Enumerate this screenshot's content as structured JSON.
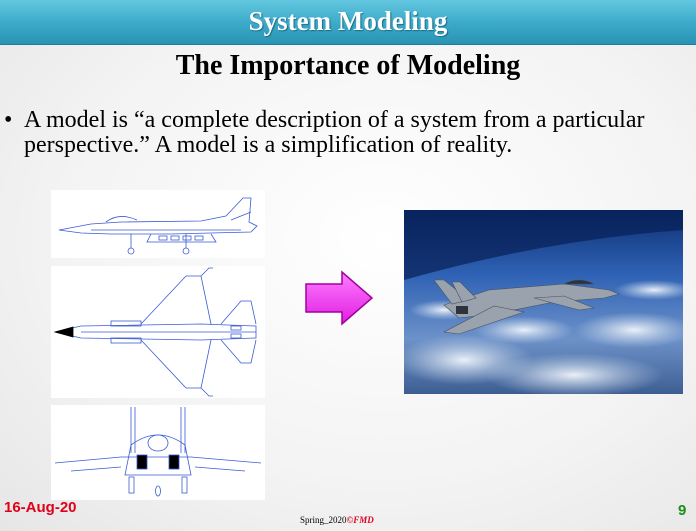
{
  "header": {
    "title": "System Modeling"
  },
  "slide": {
    "title": "The Importance of Modeling",
    "bullet_symbol": "•",
    "bullet_text": "A model is “a complete description of a system from a particular perspective.” A model is a simplification of reality."
  },
  "footer": {
    "date": "16-Aug-20",
    "center_prefix": "Spring_2020",
    "center_symbol": "©",
    "center_brand": "FMD",
    "page": "9"
  },
  "colors": {
    "header_bar": "#3aa9c8",
    "arrow_fill": "#ff33ff",
    "date_text": "#e0001b",
    "page_text": "#1a8f1a",
    "blueprint_line": "#3a5bd6"
  },
  "icons": {
    "arrow": "right-arrow-icon"
  }
}
